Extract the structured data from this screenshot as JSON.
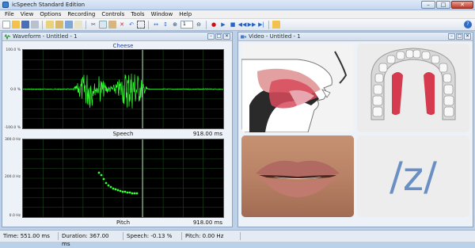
{
  "window": {
    "title": "icSpeech Standard Edition",
    "min": "–",
    "max": "□",
    "close": "✕"
  },
  "menu": [
    "File",
    "View",
    "Options",
    "Recording",
    "Controls",
    "Tools",
    "Window",
    "Help"
  ],
  "toolbar": {
    "zoom_select": "1"
  },
  "waveform_panel": {
    "title": "Waveform - Untitled - 1",
    "top_chart": {
      "title": "Cheese",
      "ytick_top": "100.0 %",
      "ytick_mid": "0.0 %",
      "ytick_bottom": "-100.0 %",
      "footer_name": "Speech",
      "footer_value": "918.00 ms"
    },
    "bottom_chart": {
      "ytick_top": "300.0 Hz",
      "ytick_mid": "200.0 Hz",
      "ytick_bottom": "0.0 Hz",
      "footer_name": "Pitch",
      "footer_value": "918.00 ms"
    }
  },
  "video_panel": {
    "title": "Video - Untitled - 1",
    "phoneme": "/z/"
  },
  "status": {
    "time": "Time: 551.00 ms",
    "duration": "Duration: 367.00 ms",
    "speech": "Speech: -0.13 %",
    "pitch": "Pitch: 0.00 Hz"
  },
  "colors": {
    "trace": "#33ff33",
    "pitch_dot": "#33ff33",
    "grid": "#1b4a1b",
    "cursor": "#bfbfbf",
    "phoneme": "#6a8fc4"
  }
}
